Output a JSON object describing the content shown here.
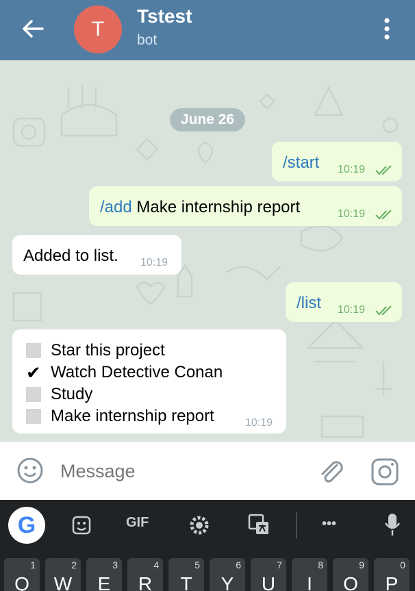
{
  "header": {
    "avatar_letter": "T",
    "title": "Tstest",
    "subtitle": "bot",
    "color": "#527da3"
  },
  "chat": {
    "date": "June 26",
    "messages": [
      {
        "dir": "out",
        "command": "/start",
        "text": "",
        "time": "10:19",
        "status": "read"
      },
      {
        "dir": "out",
        "command": "/add",
        "text": " Make internship report",
        "time": "10:19",
        "status": "read"
      },
      {
        "dir": "in",
        "text": "Added to list.",
        "time": "10:19"
      },
      {
        "dir": "out",
        "command": "/list",
        "text": "",
        "time": "10:19",
        "status": "read"
      }
    ],
    "list_message": {
      "time": "10:19",
      "items": [
        {
          "text": "Star this project",
          "done": false
        },
        {
          "text": "Watch Detective Conan",
          "done": true
        },
        {
          "text": "Study",
          "done": false
        },
        {
          "text": "Make internship report",
          "done": false
        }
      ],
      "check_glyph": "✔"
    }
  },
  "input": {
    "placeholder": "Message"
  },
  "keyboard": {
    "toolbar": [
      "G",
      "GIF",
      "•••"
    ],
    "keys": [
      {
        "label": "Q",
        "num": "1"
      },
      {
        "label": "W",
        "num": "2"
      },
      {
        "label": "E",
        "num": "3"
      },
      {
        "label": "R",
        "num": "4"
      },
      {
        "label": "T",
        "num": "5"
      },
      {
        "label": "Y",
        "num": "6"
      },
      {
        "label": "U",
        "num": "7"
      },
      {
        "label": "I",
        "num": "8"
      },
      {
        "label": "O",
        "num": "9"
      },
      {
        "label": "P",
        "num": "0"
      }
    ]
  }
}
